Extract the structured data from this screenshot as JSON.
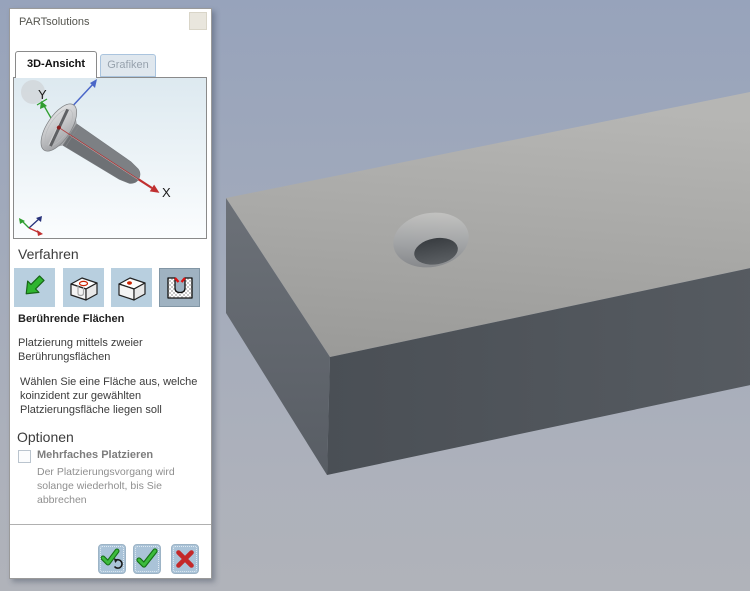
{
  "window": {
    "title": "PARTsolutions"
  },
  "tabs": {
    "view3d": "3D-Ansicht",
    "graphics": "Grafiken"
  },
  "preview": {
    "axis_x": "X",
    "axis_y": "Y"
  },
  "method": {
    "heading": "Verfahren",
    "tools": [
      {
        "name": "direct-placement",
        "icon": "green-arrow-icon",
        "selected": false
      },
      {
        "name": "placement-hidden-hole",
        "icon": "cube-hidden-hole-icon",
        "selected": false
      },
      {
        "name": "placement-point",
        "icon": "cube-point-icon",
        "selected": false
      },
      {
        "name": "contact-faces",
        "icon": "groove-section-icon",
        "selected": true
      }
    ],
    "title": "Berührende Flächen",
    "description": "Platzierung mittels zweier Berührungsflächen",
    "instruction": "Wählen Sie eine Fläche aus, welche koinzident zur gewählten Platzierungsfläche liegen soll"
  },
  "options": {
    "heading": "Optionen",
    "multiple_label": "Mehrfaches Platzieren",
    "multiple_checked": false,
    "multiple_description": "Der Platzierungsvorgang wird solange wiederholt, bis Sie abbrechen"
  },
  "footer": {
    "buttons": [
      {
        "name": "apply-repeat",
        "icon": "check-repeat-icon"
      },
      {
        "name": "ok",
        "icon": "check-icon"
      },
      {
        "name": "cancel",
        "icon": "red-x-icon"
      }
    ]
  },
  "colors": {
    "accent_button": "#b8cfdf",
    "accent_button_selected": "#9fb2c1",
    "ok_green": "#3dbb3d",
    "cancel_red": "#c42828",
    "viewport_top": "#97a3bb",
    "viewport_bottom": "#b0b3ba",
    "block_top_face": "#a8a8a6",
    "block_front_face": "#4e535a",
    "block_left_face": "#61666d"
  }
}
